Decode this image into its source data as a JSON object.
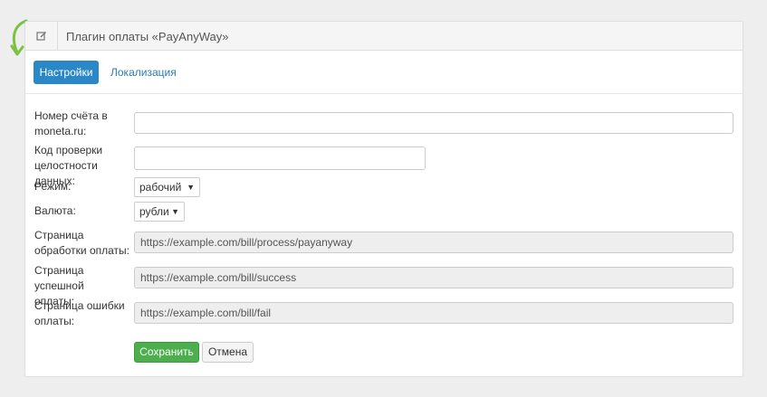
{
  "panel": {
    "title": "Плагин оплаты «PayAnyWay»",
    "icon": "edit-icon"
  },
  "tabs": [
    {
      "label": "Настройки",
      "active": true
    },
    {
      "label": "Локализация",
      "active": false
    }
  ],
  "form": {
    "account": {
      "label": "Номер счёта в moneta.ru:",
      "value": ""
    },
    "integrity_code": {
      "label": "Код проверки целостности данных:",
      "value": ""
    },
    "mode": {
      "label": "Режим:",
      "selected": "рабочий"
    },
    "currency": {
      "label": "Валюта:",
      "selected": "рубли"
    },
    "process_page": {
      "label": "Страница обработки оплаты:",
      "value": "https://example.com/bill/process/payanyway"
    },
    "success_page": {
      "label": "Страница успешной оплаты:",
      "value": "https://example.com/bill/success"
    },
    "fail_page": {
      "label": "Страница ошибки оплаты:",
      "value": "https://example.com/bill/fail"
    }
  },
  "buttons": {
    "save": "Сохранить",
    "cancel": "Отмена"
  },
  "colors": {
    "accent": "#2a88c8",
    "success": "#4cae4c",
    "arrow": "#7cc242"
  }
}
